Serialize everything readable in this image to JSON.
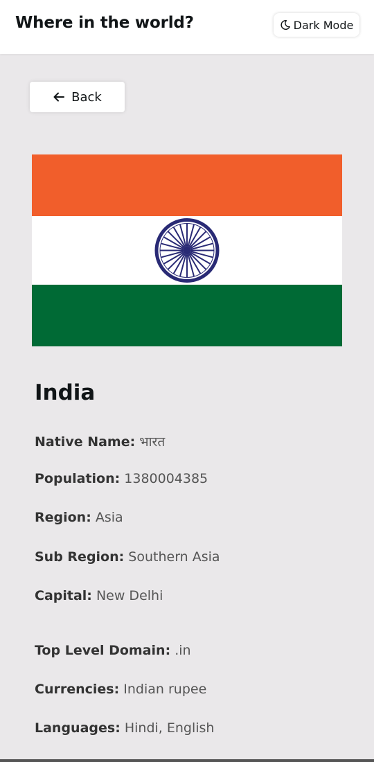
{
  "header": {
    "title": "Where in the world?",
    "dark_mode_label": "Dark Mode",
    "dark_mode_icon": "moon-icon"
  },
  "back": {
    "label": "Back",
    "icon": "arrow-left-icon"
  },
  "flag": {
    "colors": {
      "saffron": "#F15E2B",
      "white": "#FFFFFF",
      "green": "#006A35",
      "chakra": "#292A75"
    }
  },
  "country": {
    "name": "India",
    "details": [
      {
        "label": "Native Name:",
        "value": "भारत"
      },
      {
        "label": "Population:",
        "value": "1380004385"
      },
      {
        "label": "Region:",
        "value": "Asia"
      },
      {
        "label": "Sub Region:",
        "value": "Southern Asia"
      },
      {
        "label": "Capital:",
        "value": "New Delhi"
      },
      {
        "label": "Top Level Domain:",
        "value": ".in"
      },
      {
        "label": "Currencies:",
        "value": "Indian rupee"
      },
      {
        "label": "Languages:",
        "value": "Hindi, English"
      }
    ]
  },
  "colors": {
    "background": "#EAE8EA",
    "surface": "#FFFFFF",
    "text": "#111517"
  }
}
